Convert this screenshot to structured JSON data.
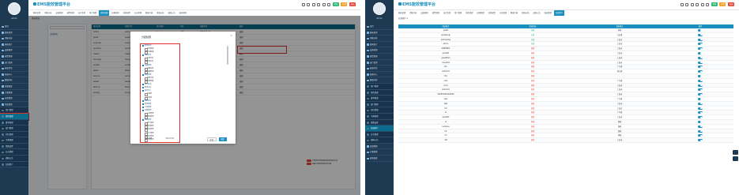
{
  "app": {
    "title": "EMS能效管理平台",
    "user": "admin"
  },
  "colors": {
    "sidebar": "#1e3a52",
    "accent": "#1a8fc0",
    "active": "#0a6b8c",
    "red_highlight": "#e0302a",
    "green": "#2bb673",
    "red_value": "#e3473b"
  },
  "top_badges": [
    {
      "label": "消息",
      "color": "#2bb673"
    },
    {
      "label": "告警",
      "color": "#f0a020"
    },
    {
      "label": "退出",
      "color": "#e3473b"
    }
  ],
  "tools": [
    "search-icon",
    "refresh-icon",
    "settings-icon",
    "fullscreen-icon",
    "lock-icon",
    "bell-icon"
  ],
  "left": {
    "tabs": [
      {
        "label": "能耗监测"
      },
      {
        "label": "用能分析"
      },
      {
        "label": "设备管理"
      },
      {
        "label": "报警管理"
      },
      {
        "label": "运行监测"
      },
      {
        "label": "用户管理"
      },
      {
        "label": "角色管理",
        "active": true
      },
      {
        "label": "权限管理"
      },
      {
        "label": "系统配置"
      },
      {
        "label": "日志管理"
      },
      {
        "label": "数据字典"
      },
      {
        "label": "能源价格"
      },
      {
        "label": "通知公告"
      },
      {
        "label": "报表管理"
      }
    ],
    "crumb": "角色管理",
    "menu": [
      {
        "label": "首页"
      },
      {
        "label": "能耗监测"
      },
      {
        "label": "用能分析"
      },
      {
        "label": "能耗统计"
      },
      {
        "label": "设备管理"
      },
      {
        "label": "报警管理"
      },
      {
        "label": "运行监测"
      },
      {
        "label": "能效评估"
      },
      {
        "label": "报表中心"
      },
      {
        "label": "数据分析"
      },
      {
        "label": "能源调度"
      },
      {
        "label": "计量管理"
      },
      {
        "label": "运维管理"
      },
      {
        "label": "系统管理"
      },
      {
        "label": "用户管理",
        "sub": true
      },
      {
        "label": "角色管理",
        "sub": true,
        "active": true
      },
      {
        "label": "菜单管理",
        "sub": true
      },
      {
        "label": "部门管理",
        "sub": true
      },
      {
        "label": "岗位管理",
        "sub": true
      },
      {
        "label": "字典管理",
        "sub": true
      },
      {
        "label": "参数设置",
        "sub": true
      },
      {
        "label": "日志管理",
        "sub": true
      },
      {
        "label": "通知公告",
        "sub": true
      },
      {
        "label": "在线用户",
        "sub": true
      }
    ],
    "tree_node": "全部角色",
    "table": {
      "columns": [
        "角色名称",
        "权限字符",
        "显示顺序",
        "状态",
        "创建时间",
        "操作"
      ],
      "rows": [
        [
          "admin",
          "admin",
          "1",
          "正常",
          "2023-01-01",
          "编辑"
        ],
        [
          "guest",
          "guest",
          "2",
          "正常",
          "2023-01-02",
          "编辑"
        ],
        [
          "engineer",
          "engineer",
          "3",
          "正常",
          "2023-01-03",
          "编辑"
        ],
        [
          "operator",
          "operator",
          "4",
          "正常",
          "2023-01-04",
          "编辑"
        ],
        [
          "viewer",
          "viewer",
          "5",
          "正常",
          "2023-01-05",
          "编辑"
        ],
        [
          "manager",
          "manager",
          "6",
          "正常",
          "2023-01-06",
          "编辑"
        ],
        [
          "auditor",
          "auditor",
          "7",
          "正常",
          "2023-01-07",
          "编辑"
        ],
        [
          "tester",
          "tester",
          "8",
          "正常",
          "2023-01-08",
          "编辑"
        ],
        [
          "service",
          "service",
          "9",
          "正常",
          "2023-01-09",
          "编辑"
        ],
        [
          "leader",
          "leader",
          "10",
          "正常",
          "2023-01-10",
          "编辑"
        ],
        [
          "finance",
          "finance",
          "11",
          "正常",
          "2023-01-11",
          "编辑"
        ],
        [
          "energy",
          "energy",
          "12",
          "正常",
          "2023-01-12",
          "编辑"
        ]
      ]
    },
    "modal": {
      "title": "分配权限",
      "cancel": "取消",
      "confirm": "确定",
      "footer_left": "展开/折叠",
      "footer_right": "全选/全不选",
      "perms": [
        {
          "label": "能耗监测"
        },
        {
          "label": "实时数据",
          "child": true
        },
        {
          "label": "历史数据",
          "child": true
        },
        {
          "label": "用能分析"
        },
        {
          "label": "分项分析",
          "child": true
        },
        {
          "label": "区域分析",
          "child": true
        },
        {
          "label": "设备管理"
        },
        {
          "label": "设备台账",
          "child": true
        },
        {
          "label": "设备档案",
          "child": true
        },
        {
          "label": "报警管理"
        },
        {
          "label": "报警记录",
          "child": true
        },
        {
          "label": "报警配置",
          "child": true
        },
        {
          "label": "运行监测"
        },
        {
          "label": "能效评估"
        },
        {
          "label": "报表中心"
        },
        {
          "label": "日报表",
          "child": true
        },
        {
          "label": "月报表",
          "child": true
        },
        {
          "label": "数据分析"
        },
        {
          "label": "能源调度"
        },
        {
          "label": "计量管理"
        },
        {
          "label": "运维管理"
        },
        {
          "label": "工单管理",
          "child": true
        },
        {
          "label": "巡检管理",
          "child": true
        },
        {
          "label": "系统管理"
        },
        {
          "label": "用户管理",
          "child": true
        },
        {
          "label": "角色管理",
          "child": true
        },
        {
          "label": "菜单管理",
          "child": true
        },
        {
          "label": "部门管理",
          "child": true
        },
        {
          "label": "岗位管理",
          "child": true
        },
        {
          "label": "字典管理",
          "child": true
        }
      ]
    },
    "warnings": [
      "当前角色分配权限后需重新登录生效",
      "请确认分配的权限是否正确"
    ]
  },
  "right": {
    "tabs": [
      {
        "label": "能耗监测"
      },
      {
        "label": "用能分析"
      },
      {
        "label": "设备管理"
      },
      {
        "label": "报警管理"
      },
      {
        "label": "运行监测"
      },
      {
        "label": "用户管理"
      },
      {
        "label": "角色管理"
      },
      {
        "label": "权限管理"
      },
      {
        "label": "系统配置"
      },
      {
        "label": "日志管理"
      },
      {
        "label": "数据字典"
      },
      {
        "label": "能源价格"
      },
      {
        "label": "通知公告"
      },
      {
        "label": "报表管理"
      },
      {
        "label": "在线用户",
        "active": true
      }
    ],
    "crumb": "在线用户 ▾",
    "menu": [
      {
        "label": "首页"
      },
      {
        "label": "能耗监测"
      },
      {
        "label": "用能分析"
      },
      {
        "label": "能耗统计"
      },
      {
        "label": "设备管理"
      },
      {
        "label": "报警管理"
      },
      {
        "label": "运行监测"
      },
      {
        "label": "能效评估"
      },
      {
        "label": "报表中心"
      },
      {
        "label": "数据分析"
      },
      {
        "label": "用户管理",
        "sub": true
      },
      {
        "label": "角色管理",
        "sub": true
      },
      {
        "label": "菜单管理",
        "sub": true
      },
      {
        "label": "部门管理",
        "sub": true
      },
      {
        "label": "岗位管理",
        "sub": true
      },
      {
        "label": "字典管理",
        "sub": true
      },
      {
        "label": "参数设置",
        "sub": true
      },
      {
        "label": "在线用户",
        "sub": true,
        "active": true
      },
      {
        "label": "日志管理",
        "sub": true
      },
      {
        "label": "通知公告",
        "sub": true
      },
      {
        "label": "运维管理"
      },
      {
        "label": "计量管理"
      },
      {
        "label": "能源调度"
      }
    ],
    "columns": [
      "登录账号",
      "登录状态",
      "登录地点",
      "操作"
    ],
    "rows": [
      [
        "guest",
        "在线",
        "本机",
        ""
      ],
      [
        "guest/engi",
        "在线",
        "江苏省",
        ""
      ],
      [
        "admin/engi",
        "在线",
        "上海市",
        ""
      ],
      [
        "admin",
        "在线",
        "上海市",
        ""
      ],
      [
        "SUNHEO1",
        "离线",
        "上海市",
        ""
      ],
      [
        "guest01",
        "离线",
        "上海市",
        ""
      ],
      [
        "guest/fam",
        "离线",
        "上海市",
        ""
      ],
      [
        "Xusu004",
        "离线",
        "上海市",
        ""
      ],
      [
        "lbu",
        "离线",
        "广东省",
        ""
      ],
      [
        "admin03",
        "离线",
        "浙江省",
        ""
      ],
      [
        "lhd",
        "离线",
        "",
        ""
      ],
      [
        "l.abc",
        "离线",
        "广东省",
        ""
      ],
      [
        "l.bcd",
        "离线",
        "上海市",
        ""
      ],
      [
        "admin01",
        "离线",
        "上海市",
        ""
      ],
      [
        "Sferfi0100ol2a00fa",
        "离线",
        "上海市",
        ""
      ],
      [
        "user",
        "离线",
        "广东省",
        ""
      ],
      [
        "test",
        "离线",
        "上海市",
        ""
      ],
      [
        "lhd",
        "离线",
        "上海市",
        ""
      ],
      [
        "ai",
        "离线",
        "广东省",
        ""
      ],
      [
        "guest02",
        "离线",
        "上海市",
        ""
      ],
      [
        "ls",
        "离线",
        "湖南",
        ""
      ],
      [
        "Lamplus",
        "离线",
        "湖南",
        ""
      ],
      [
        "lnt",
        "离线",
        "湖南",
        ""
      ],
      [
        "lnf",
        "离线",
        "湖南",
        ""
      ],
      [
        "dsf",
        "离线",
        "上海市",
        ""
      ]
    ]
  }
}
